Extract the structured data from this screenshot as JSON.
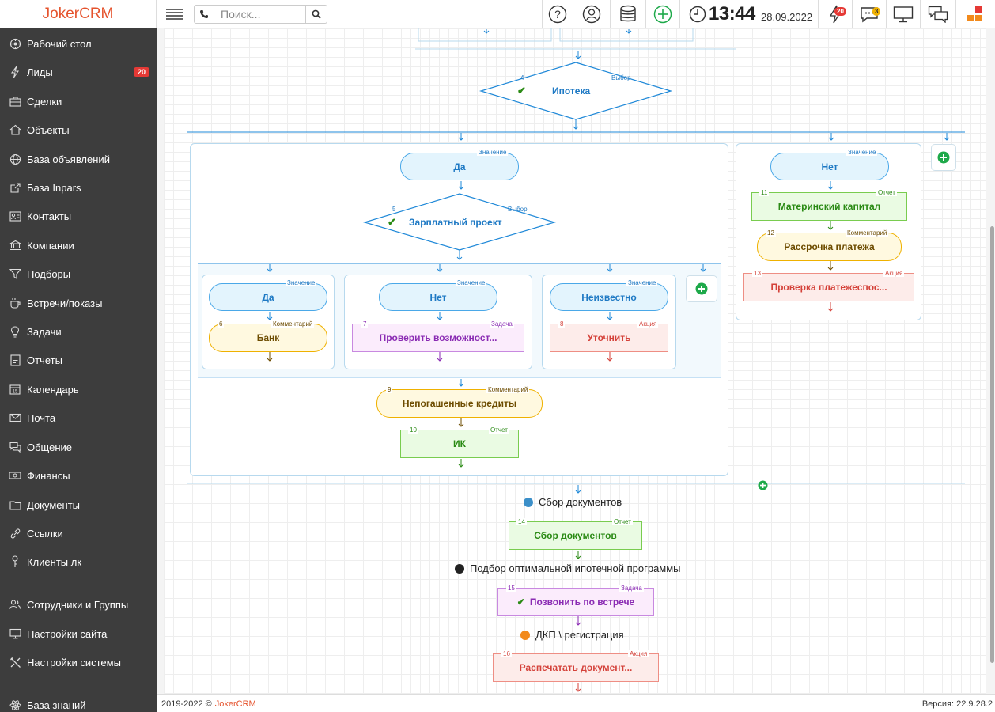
{
  "header": {
    "logo_a": "Joker",
    "logo_b": "CRM",
    "search_placeholder": "Поиск...",
    "time": "13:44",
    "date": "28.09.2022",
    "notifications_count": "20",
    "messages_count": "3"
  },
  "sidebar": {
    "items": [
      {
        "label": "Рабочий стол",
        "icon": "dashboard-icon"
      },
      {
        "label": "Лиды",
        "icon": "lightning-icon",
        "badge": "20"
      },
      {
        "label": "Сделки",
        "icon": "briefcase-icon"
      },
      {
        "label": "Объекты",
        "icon": "home-icon"
      },
      {
        "label": "База объявлений",
        "icon": "globe-icon"
      },
      {
        "label": "База Inpars",
        "icon": "external-link-icon"
      },
      {
        "label": "Контакты",
        "icon": "contacts-icon"
      },
      {
        "label": "Компании",
        "icon": "bank-icon"
      },
      {
        "label": "Подборы",
        "icon": "filter-icon"
      },
      {
        "label": "Встречи/показы",
        "icon": "coffee-icon"
      },
      {
        "label": "Задачи",
        "icon": "bulb-icon"
      },
      {
        "label": "Отчеты",
        "icon": "report-icon"
      },
      {
        "label": "Календарь",
        "icon": "calendar-icon"
      },
      {
        "label": "Почта",
        "icon": "mail-icon"
      },
      {
        "label": "Общение",
        "icon": "chat-icon"
      },
      {
        "label": "Финансы",
        "icon": "money-icon"
      },
      {
        "label": "Документы",
        "icon": "folder-icon"
      },
      {
        "label": "Ссылки",
        "icon": "link-icon"
      },
      {
        "label": "Клиенты лк",
        "icon": "key-icon"
      },
      {
        "label": "Сотрудники и Группы",
        "icon": "users-icon"
      },
      {
        "label": "Настройки сайта",
        "icon": "monitor-icon"
      },
      {
        "label": "Настройки системы",
        "icon": "tools-icon"
      },
      {
        "label": "База знаний",
        "icon": "atom-icon"
      }
    ]
  },
  "flow": {
    "choice_4": {
      "num": "4",
      "type": "Выбор",
      "label": "Ипотека"
    },
    "val_yes_1": {
      "type": "Значение",
      "label": "Да"
    },
    "choice_5": {
      "num": "5",
      "type": "Выбор",
      "label": "Зарплатный проект"
    },
    "val_yes_2": {
      "type": "Значение",
      "label": "Да"
    },
    "val_no_2": {
      "type": "Значение",
      "label": "Нет"
    },
    "val_unknown": {
      "type": "Значение",
      "label": "Неизвестно"
    },
    "n6": {
      "num": "6",
      "type": "Комментарий",
      "label": "Банк"
    },
    "n7": {
      "num": "7",
      "type": "Задача",
      "label": "Проверить возможност..."
    },
    "n8": {
      "num": "8",
      "type": "Акция",
      "label": "Уточнить"
    },
    "n9": {
      "num": "9",
      "type": "Комментарий",
      "label": "Непогашенные кредиты"
    },
    "n10": {
      "num": "10",
      "type": "Отчет",
      "label": "ИК"
    },
    "val_no_1": {
      "type": "Значение",
      "label": "Нет"
    },
    "n11": {
      "num": "11",
      "type": "Отчет",
      "label": "Материнский капитал"
    },
    "n12": {
      "num": "12",
      "type": "Комментарий",
      "label": "Рассрочка платежа"
    },
    "n13": {
      "num": "13",
      "type": "Акция",
      "label": "Проверка платежеспос..."
    },
    "stage_1": {
      "label": "Сбор документов",
      "color": "#3b8fc9"
    },
    "n14": {
      "num": "14",
      "type": "Отчет",
      "label": "Сбор документов"
    },
    "stage_2": {
      "label": "Подбор оптимальной ипотечной программы",
      "color": "#222222"
    },
    "n15": {
      "num": "15",
      "type": "Задача",
      "label": "Позвонить по встрече"
    },
    "stage_3": {
      "label": "ДКП \\ регистрация",
      "color": "#f28a1c"
    },
    "n16": {
      "num": "16",
      "type": "Акция",
      "label": "Распечатать документ..."
    }
  },
  "footer": {
    "copyright": "2019-2022 ©",
    "brand": "JokerCRM",
    "version": "Версия: 22.9.28.2"
  }
}
